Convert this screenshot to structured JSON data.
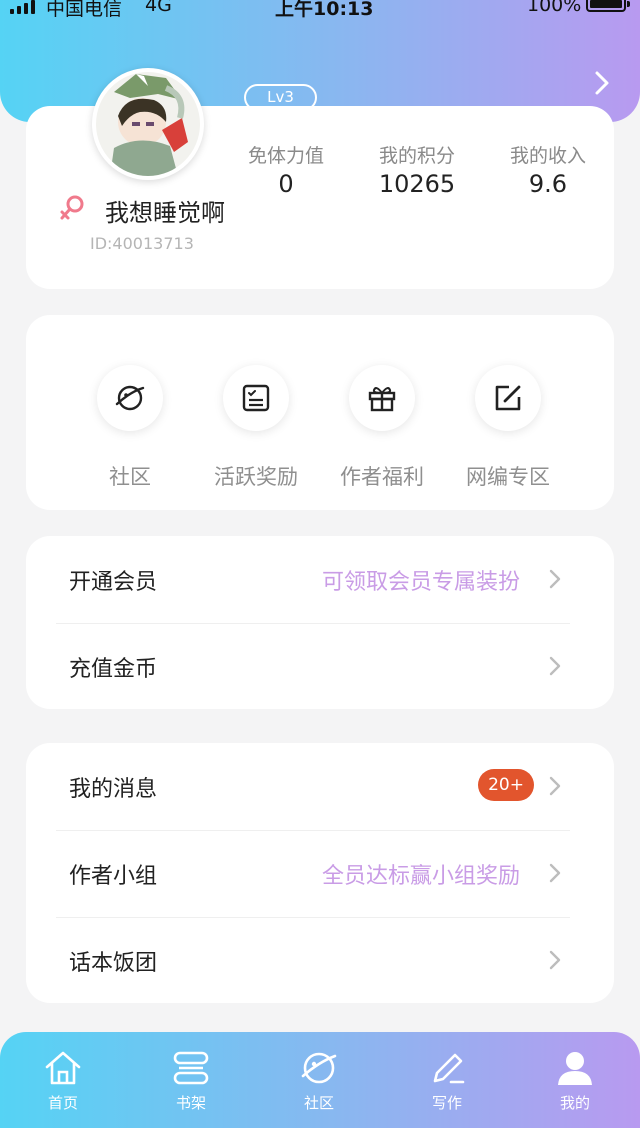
{
  "status_bar": {
    "carrier": "中国电信",
    "network": "4G",
    "time": "上午10:13",
    "battery": "100%"
  },
  "profile": {
    "level": "Lv3",
    "username": "我想睡觉啊",
    "user_id": "ID:40013713",
    "stats": [
      {
        "label": "免体力值",
        "value": "0"
      },
      {
        "label": "我的积分",
        "value": "10265"
      },
      {
        "label": "我的收入",
        "value": "9.6"
      }
    ]
  },
  "quick_menu": [
    {
      "label": "社区",
      "icon": "planet-icon"
    },
    {
      "label": "活跃奖励",
      "icon": "checklist-icon"
    },
    {
      "label": "作者福利",
      "icon": "gift-icon"
    },
    {
      "label": "网编专区",
      "icon": "edit-icon"
    }
  ],
  "list_group_1": [
    {
      "label": "开通会员",
      "hint": "可领取会员专属装扮"
    },
    {
      "label": "充值金币",
      "hint": ""
    }
  ],
  "list_group_2": [
    {
      "label": "我的消息",
      "badge": "20+"
    },
    {
      "label": "作者小组",
      "hint": "全员达标赢小组奖励"
    },
    {
      "label": "话本饭团",
      "hint": ""
    }
  ],
  "tabbar": [
    {
      "label": "首页",
      "icon": "home-icon"
    },
    {
      "label": "书架",
      "icon": "bookshelf-icon"
    },
    {
      "label": "社区",
      "icon": "planet-icon"
    },
    {
      "label": "写作",
      "icon": "pencil-icon"
    },
    {
      "label": "我的",
      "icon": "user-icon",
      "active": true
    }
  ],
  "colors": {
    "gradient_start": "#55d3f4",
    "gradient_end": "#b89af0",
    "hint": "#c99ce6",
    "badge": "#e2552d",
    "gender": "#f07a8c"
  }
}
